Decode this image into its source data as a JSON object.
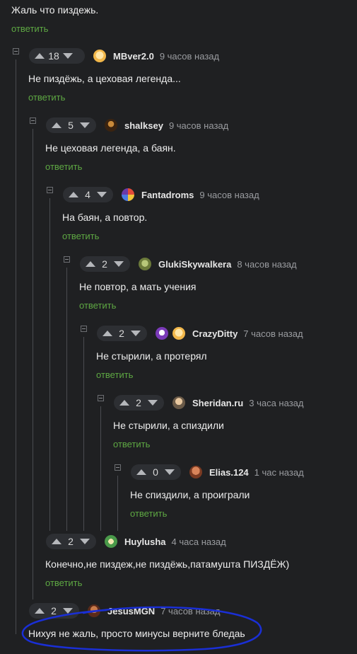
{
  "top": {
    "text": "Жаль что пиздежь.",
    "reply": "ответить"
  },
  "comments": [
    {
      "score": "18",
      "user": "MBver2.0",
      "time": "9 часов назад",
      "text": "Не пиздёжь, а цеховая легенда...",
      "reply": "ответить"
    },
    {
      "score": "5",
      "user": "shalksey",
      "time": "9 часов назад",
      "text": "Не цеховая легенда, а баян.",
      "reply": "ответить"
    },
    {
      "score": "4",
      "user": "Fantadroms",
      "time": "9 часов назад",
      "text": "На баян, а повтор.",
      "reply": "ответить"
    },
    {
      "score": "2",
      "user": "GlukiSkywalkera",
      "time": "8 часов назад",
      "text": "Не повтор, а мать учения",
      "reply": "ответить"
    },
    {
      "score": "2",
      "user": "CrazyDitty",
      "time": "7 часов назад",
      "text": "Не стырили, а протерял",
      "reply": "ответить"
    },
    {
      "score": "2",
      "user": "Sheridan.ru",
      "time": "3 часа назад",
      "text": "Не стырили, а спиздили",
      "reply": "ответить"
    },
    {
      "score": "0",
      "user": "Elias.124",
      "time": "1 час назад",
      "text": "Не спиздили, а проиграли",
      "reply": "ответить"
    },
    {
      "score": "2",
      "user": "Huylusha",
      "time": "4 часа назад",
      "text": "Конечно,не пиздеж,не пиздёжь,патамушта ПИЗДЁЖ)",
      "reply": "ответить"
    },
    {
      "score": "2",
      "user": "JesusMGN",
      "time": "7 часов назад",
      "text": "Нихуя не жаль, просто минусы верните бледаь"
    }
  ],
  "colors": {
    "accent": "#5ea843",
    "highlight": "#1a2fd6",
    "background": "#1f2022"
  }
}
